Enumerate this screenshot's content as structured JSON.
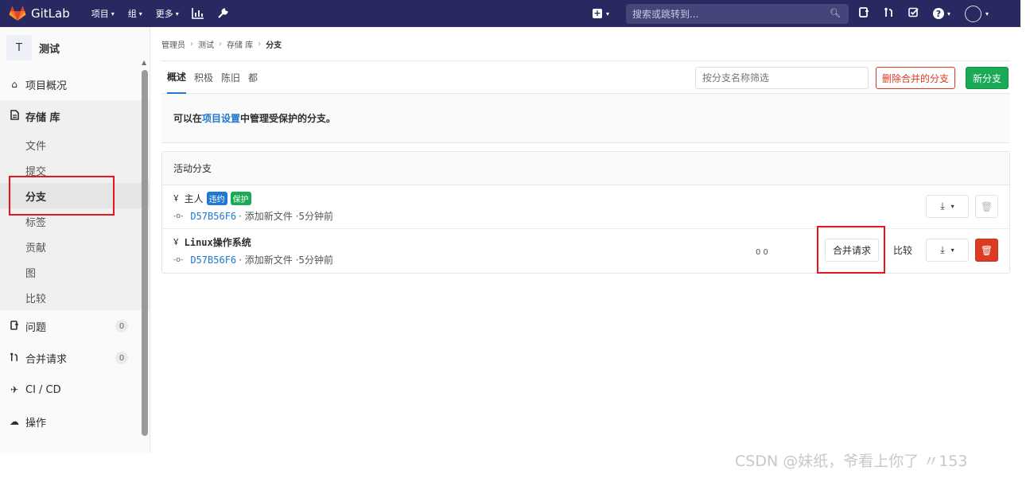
{
  "navbar": {
    "brand": "GitLab",
    "menus": [
      {
        "label": "项目"
      },
      {
        "label": "组"
      },
      {
        "label": "更多"
      }
    ],
    "search_placeholder": "搜索或跳转到...",
    "colors": {
      "background": "#292961",
      "search_bg": "#45457a"
    }
  },
  "sidebar": {
    "project_initial": "T",
    "project_name": "测试",
    "items": {
      "overview": "项目概况",
      "repository": "存储 库",
      "issues": "问题",
      "issues_count": "0",
      "merge_requests": "合并请求",
      "mr_count": "0",
      "cicd": "CI / CD",
      "operations": "操作"
    },
    "repo_sub": [
      "文件",
      "提交",
      "分支",
      "标签",
      "贡献",
      "图",
      "比较"
    ]
  },
  "breadcrumb": [
    "管理员",
    "测试",
    "存储 库",
    "分支"
  ],
  "tabs": [
    "概述",
    "积极",
    "陈旧",
    "都"
  ],
  "filter_placeholder": "按分支名称筛选",
  "buttons": {
    "delete_merged": "删除合并的分支",
    "new_branch": "新分支"
  },
  "notice": {
    "prefix": "可以在",
    "link": "项目设置",
    "suffix": "中管理受保护的分支。"
  },
  "panel_title": "活动分支",
  "branches": [
    {
      "name": "主人",
      "badges": [
        "违约",
        "保护"
      ],
      "sha": "D57B56F6",
      "message": "· 添加新文件 ·5分钟前"
    },
    {
      "name": "Linux操作系统",
      "divergence": "0 0",
      "sha": "D57B56F6",
      "message": "· 添加新文件 ·5分钟前",
      "merge_request": "合并请求",
      "compare": "比较"
    }
  ],
  "watermark": "CSDN @妹纸，爷看上你了 〃153",
  "colors": {
    "accent": "#1f78d1",
    "success": "#1aaa55",
    "danger": "#db3b21",
    "annotation": "#e5141d"
  }
}
